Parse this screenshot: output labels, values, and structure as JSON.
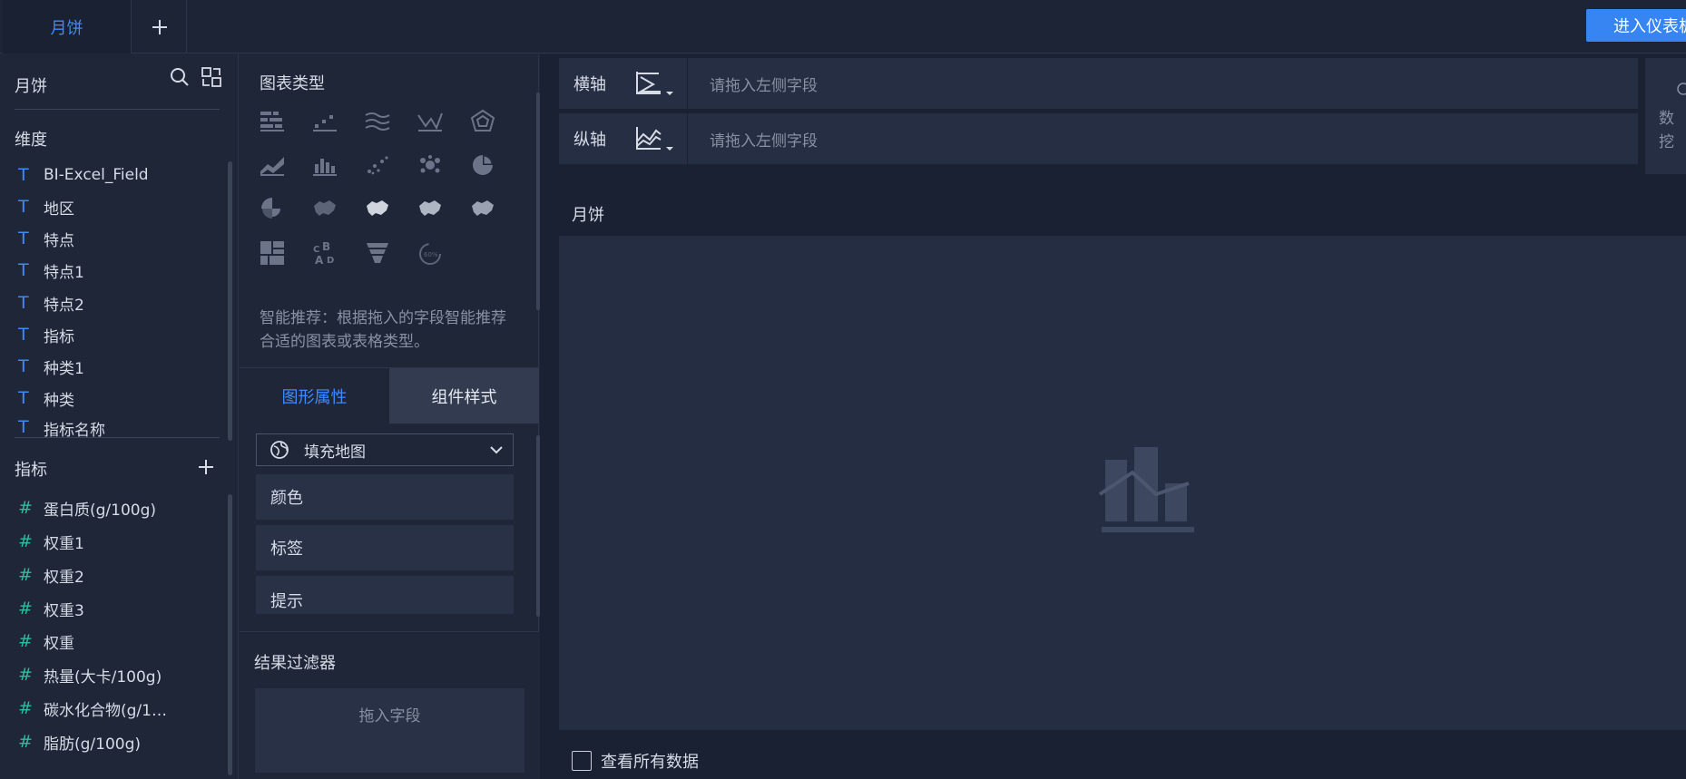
{
  "topbar": {
    "active_tab": "月饼",
    "add_tab_icon": "plus-icon",
    "enter_button": "进入仪表板"
  },
  "left_panel": {
    "dataset_title": "月饼",
    "search_icon": "search-icon",
    "switch_icon": "switch-dataset-icon",
    "dimensions_title": "维度",
    "dimensions": [
      "BI-Excel_Field",
      "地区",
      "特点",
      "特点1",
      "特点2",
      "指标",
      "种类1",
      "种类",
      "指标名称"
    ],
    "measures_title": "指标",
    "measures": [
      "蛋白质(g/100g)",
      "权重1",
      "权重2",
      "权重3",
      "权重",
      "热量(大卡/100g)",
      "碳水化合物(g/1…",
      "脂肪(g/100g)"
    ]
  },
  "middle_panel": {
    "chart_types_title": "图表类型",
    "smart_hint": "智能推荐：根据拖入的字段智能推荐合适的图表或表格类型。",
    "tab_graphic_props": "图形属性",
    "tab_component_style": "组件样式",
    "chart_select_value": "填充地图",
    "props": [
      "颜色",
      "标签",
      "提示"
    ],
    "filter_title": "结果过滤器",
    "filter_drop": "拖入字段"
  },
  "main": {
    "x_axis_label": "横轴",
    "x_axis_placeholder": "请拖入左侧字段",
    "y_axis_label": "纵轴",
    "y_axis_placeholder": "请拖入左侧字段",
    "side_text_1": "数",
    "side_text_2": "挖",
    "chart_name": "月饼",
    "view_all_label": "查看所有数据"
  },
  "colors": {
    "accent": "#3d8bff",
    "measure": "#2dbd9c",
    "primary_button": "#3685f2",
    "background": "#1a2133"
  }
}
